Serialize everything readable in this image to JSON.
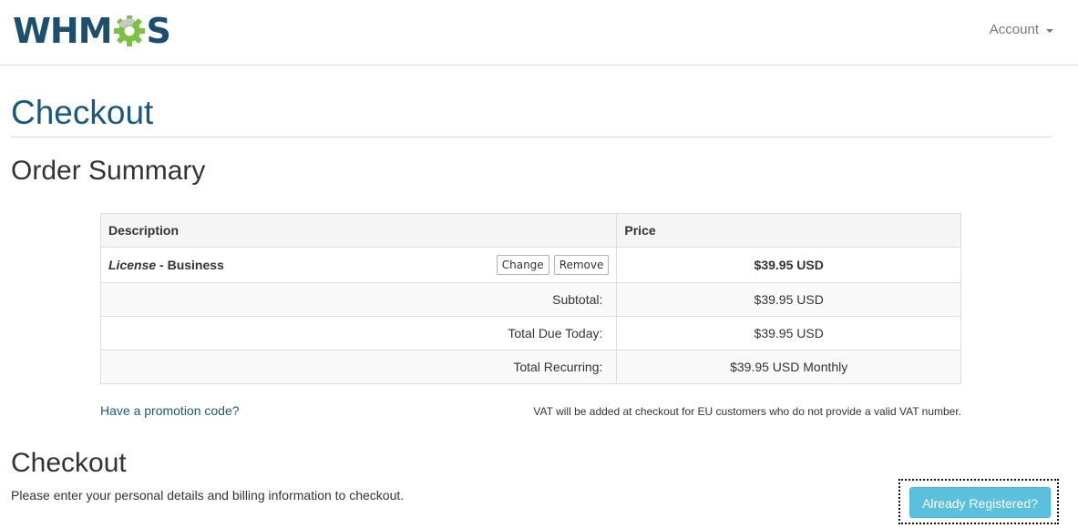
{
  "header": {
    "logo_text_left": "WHM",
    "logo_text_right": "S",
    "account_label": "Account"
  },
  "page": {
    "title": "Checkout",
    "order_summary_title": "Order Summary"
  },
  "table": {
    "headers": {
      "description": "Description",
      "price": "Price"
    },
    "item": {
      "product": "License",
      "separator": " - ",
      "plan": "Business",
      "change_label": "Change",
      "remove_label": "Remove",
      "price": "$39.95 USD"
    },
    "totals": [
      {
        "label": "Subtotal:",
        "value": "$39.95 USD"
      },
      {
        "label": "Total Due Today:",
        "value": "$39.95 USD"
      },
      {
        "label": "Total Recurring:",
        "value": "$39.95 USD Monthly"
      }
    ]
  },
  "promo_link": "Have a promotion code?",
  "vat_note": "VAT will be added at checkout for EU customers who do not provide a valid VAT number.",
  "checkout": {
    "title": "Checkout",
    "description": "Please enter your personal details and billing information to checkout.",
    "already_registered_label": "Already Registered?"
  },
  "colors": {
    "brand_dark": "#1c4f6e",
    "brand_green": "#7ac143",
    "link": "#1a587f",
    "info_button": "#5bc0de"
  },
  "icons": {
    "logo_gear": "gear-icon",
    "account_caret": "caret-down-icon"
  }
}
